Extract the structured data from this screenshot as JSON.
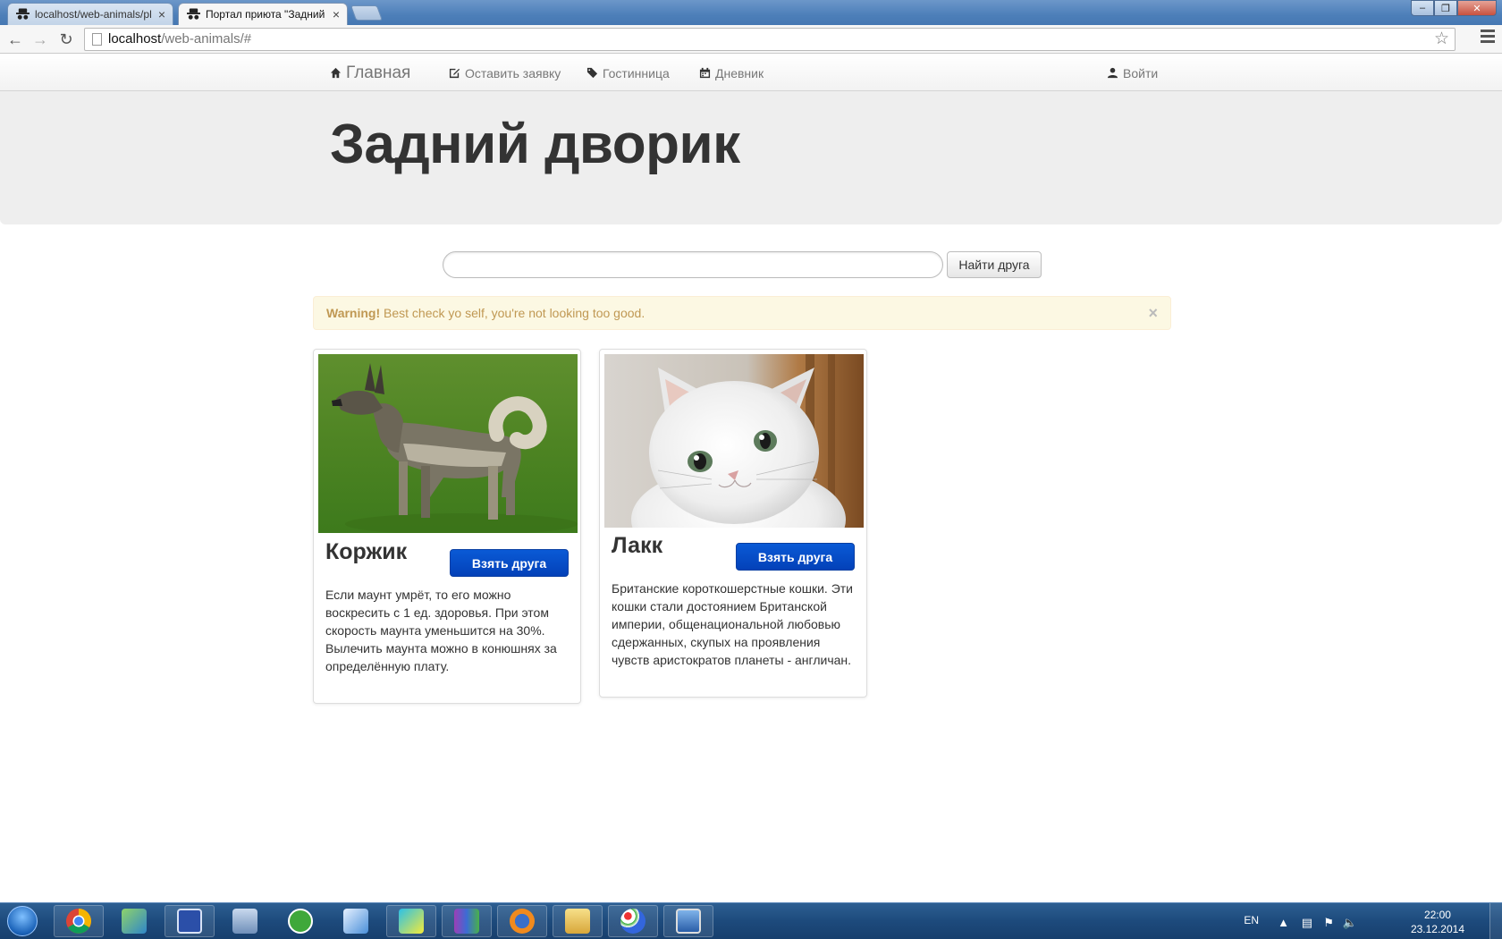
{
  "browser": {
    "tabs": [
      {
        "title": "localhost/web-animals/pl",
        "active": false
      },
      {
        "title": "Портал приюта \"Задний",
        "active": true
      }
    ],
    "url_host": "localhost",
    "url_path": "/web-animals/#",
    "window_buttons": {
      "minimize": "–",
      "restore": "❐",
      "close": "✕"
    }
  },
  "nav": {
    "brand": "Главная",
    "items": [
      {
        "label": "Оставить заявку",
        "icon": "edit-icon"
      },
      {
        "label": "Гостинница",
        "icon": "tags-icon"
      },
      {
        "label": "Дневник",
        "icon": "calendar-icon"
      }
    ],
    "login": "Войти"
  },
  "hero": {
    "title": "Задний дворик"
  },
  "search": {
    "value": "",
    "button": "Найти друга"
  },
  "alert": {
    "strong": "Warning!",
    "text": " Best check yo self, you're not looking too good.",
    "close": "×"
  },
  "animals": [
    {
      "name": "Коржик",
      "button": "Взять друга",
      "description": "Если маунт умрёт, то его можно воскресить с 1 ед. здоровья. При этом скорость маунта уменьшится на 30%. Вылечить маунта можно в конюшнях за определённую плату."
    },
    {
      "name": "Лакк",
      "button": "Взять друга",
      "description": "Британские короткошерстные кошки. Эти кошки стали достоянием Британской империи, общенациональной любовью сдержанных, скупых на проявления чувств аристократов планеты - англичан."
    }
  ],
  "taskbar": {
    "language": "EN",
    "time": "22:00",
    "date": "23.12.2014",
    "apps": [
      "chrome",
      "network-tool",
      "save-app",
      "database-app",
      "utorrent",
      "notepad",
      "webstorm",
      "winrar",
      "firefox",
      "file-explorer",
      "paint",
      "remote-desktop"
    ]
  },
  "colors": {
    "primary_button": "#0341b8",
    "alert_bg": "#fcf8e3",
    "alert_text": "#c09853",
    "jumbotron_bg": "#eeeeee"
  }
}
